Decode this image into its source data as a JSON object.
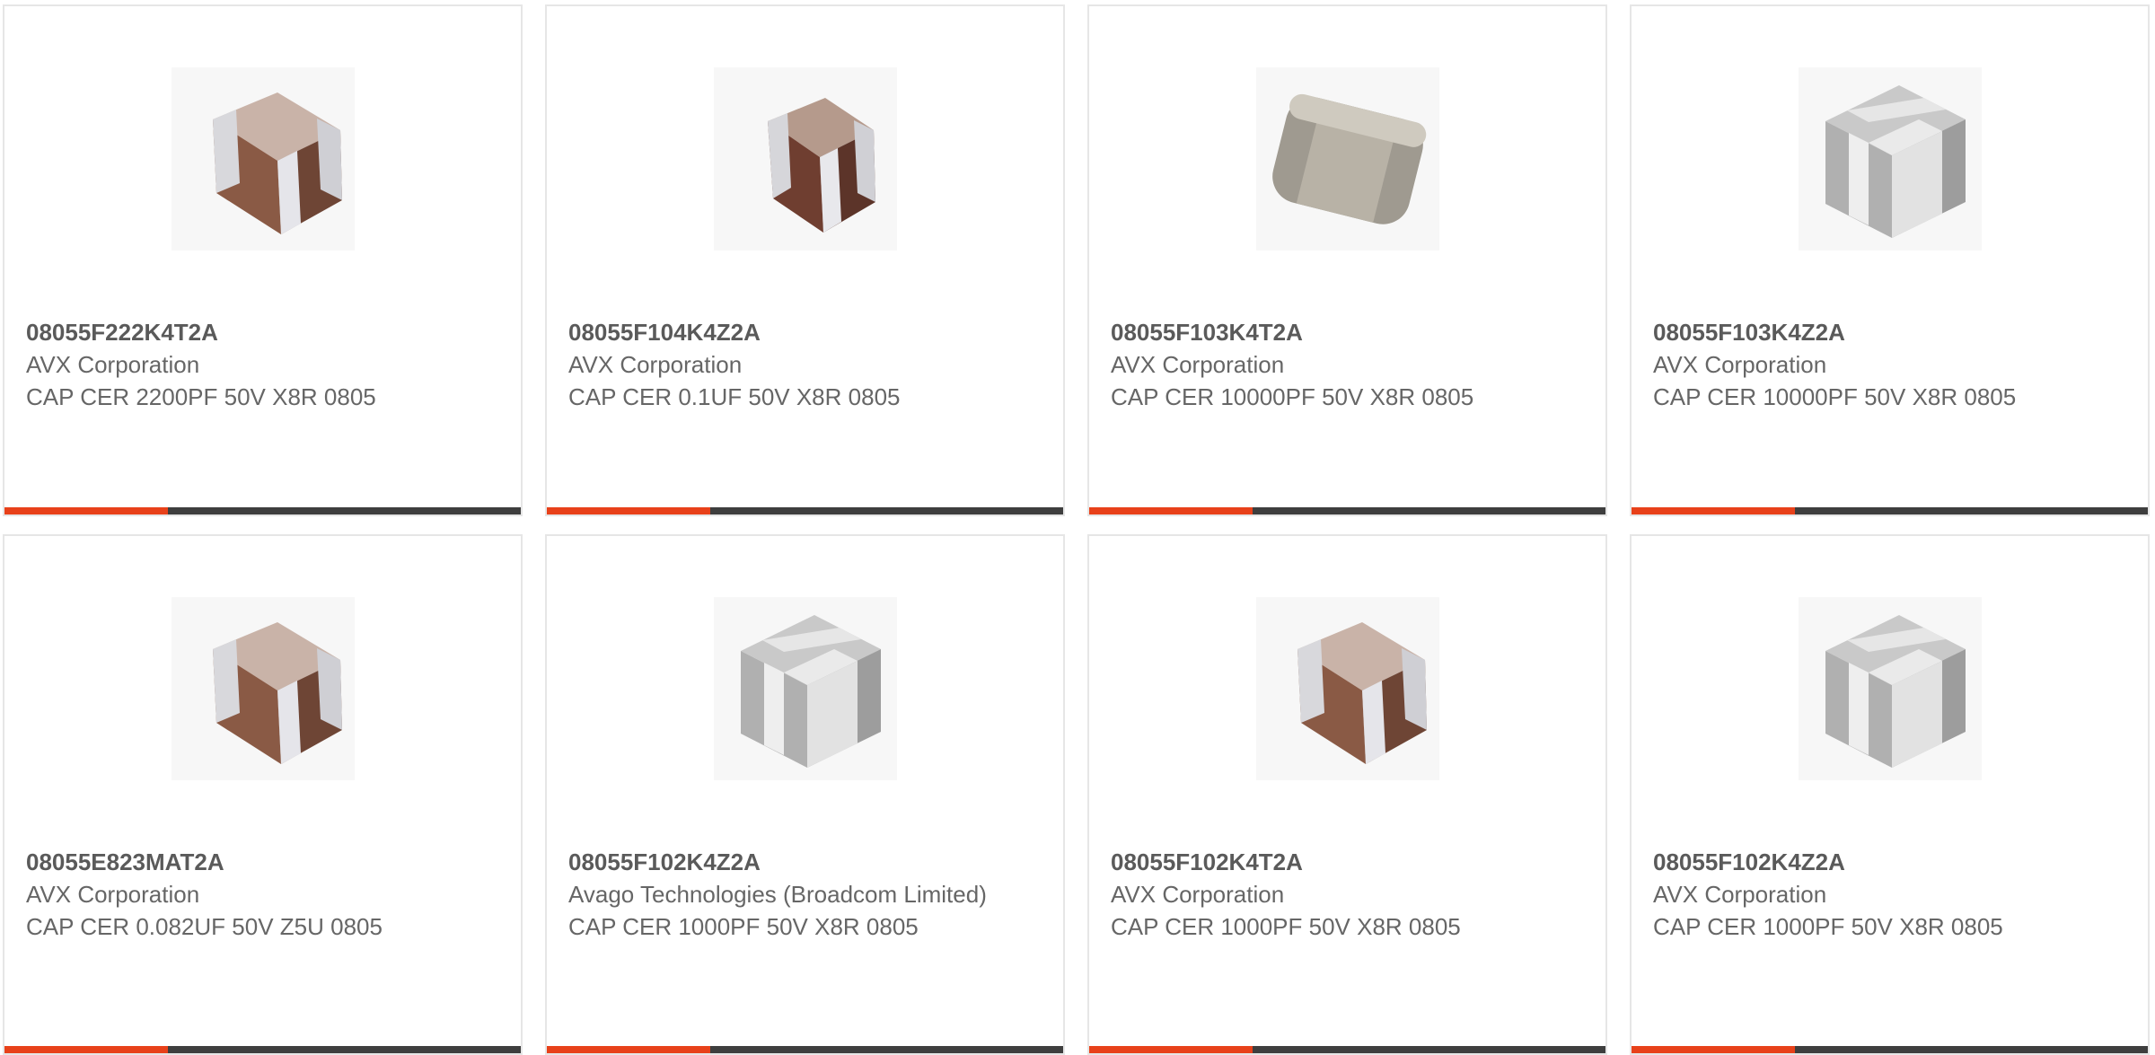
{
  "products": [
    {
      "part_number": "08055F222K4T2A",
      "manufacturer": "AVX Corporation",
      "description": "CAP CER 2200PF 50V X8R 0805",
      "image": "brown-capacitor-icon"
    },
    {
      "part_number": "08055F104K4Z2A",
      "manufacturer": "AVX Corporation",
      "description": "CAP CER 0.1UF 50V X8R 0805",
      "image": "brown-capacitor-icon"
    },
    {
      "part_number": "08055F103K4T2A",
      "manufacturer": "AVX Corporation",
      "description": "CAP CER 10000PF 50V X8R 0805",
      "image": "grey-rounded-capacitor-icon"
    },
    {
      "part_number": "08055F103K4Z2A",
      "manufacturer": "AVX Corporation",
      "description": "CAP CER 10000PF 50V X8R 0805",
      "image": "white-capacitor-icon"
    },
    {
      "part_number": "08055E823MAT2A",
      "manufacturer": "AVX Corporation",
      "description": "CAP CER 0.082UF 50V Z5U 0805",
      "image": "brown-capacitor-icon"
    },
    {
      "part_number": "08055F102K4Z2A",
      "manufacturer": "Avago Technologies (Broadcom Limited)",
      "description": "CAP CER 1000PF 50V X8R 0805",
      "image": "white-capacitor-icon"
    },
    {
      "part_number": "08055F102K4T2A",
      "manufacturer": "AVX Corporation",
      "description": "CAP CER 1000PF 50V X8R 0805",
      "image": "brown-capacitor-icon"
    },
    {
      "part_number": "08055F102K4Z2A",
      "manufacturer": "AVX Corporation",
      "description": "CAP CER 1000PF 50V X8R 0805",
      "image": "white-capacitor-icon"
    }
  ],
  "colors": {
    "accent": "#e8411a",
    "bar": "#3e3e3e",
    "text": "#666666"
  }
}
